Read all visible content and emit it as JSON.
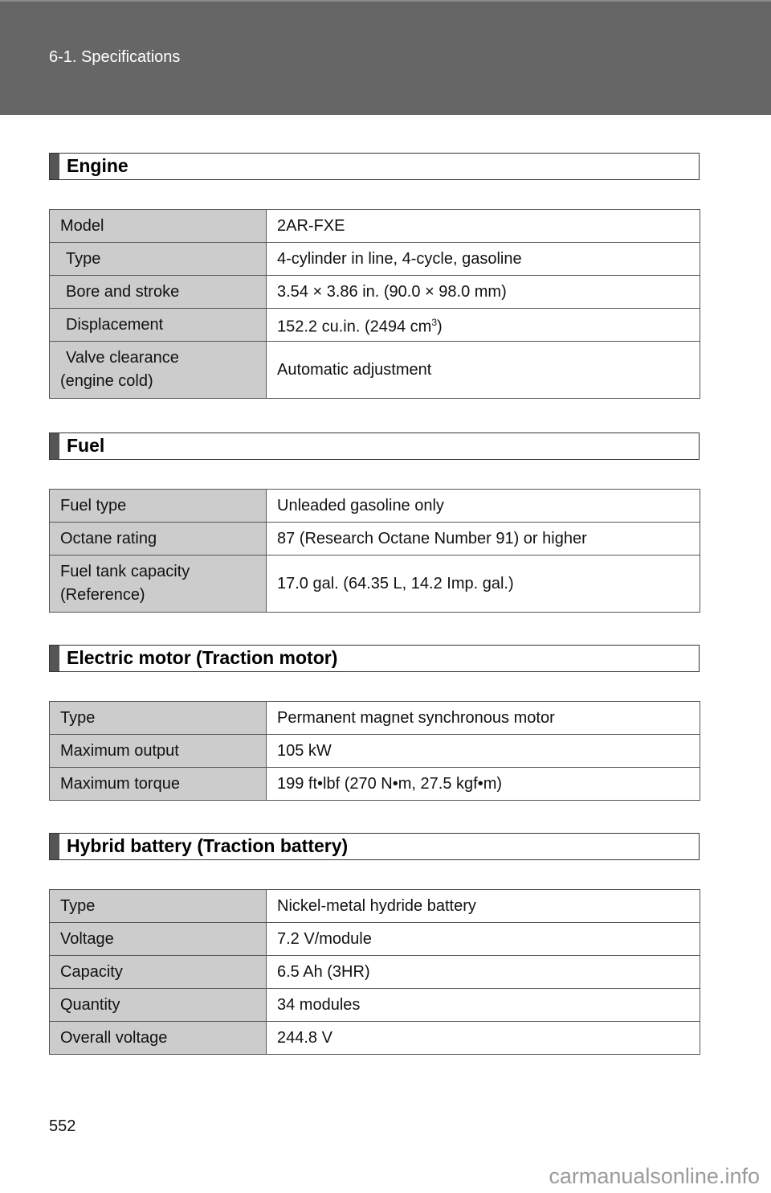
{
  "header": {
    "breadcrumb": "6-1. Specifications"
  },
  "sections": [
    {
      "title": "Engine",
      "rows": [
        {
          "key": "Model",
          "value": "2AR-FXE"
        },
        {
          "key": "Type",
          "value": "4-cylinder in line, 4-cycle, gasoline"
        },
        {
          "key": "Bore and stroke",
          "value": "3.54 × 3.86 in. (90.0 × 98.0 mm)"
        },
        {
          "key": "Displacement",
          "value": "152.2 cu.in. (2494 cm",
          "value_sup": "3",
          "value_after": ")"
        },
        {
          "key": "Valve clearance",
          "key_line2": "(engine cold)",
          "value": "Automatic adjustment"
        }
      ]
    },
    {
      "title": "Fuel",
      "rows": [
        {
          "key": "Fuel type",
          "value": "Unleaded gasoline only"
        },
        {
          "key": "Octane rating",
          "value": "87 (Research Octane Number 91) or higher"
        },
        {
          "key": "Fuel tank capacity",
          "key_line2": "(Reference)",
          "value": "17.0 gal. (64.35 L, 14.2 Imp. gal.)"
        }
      ]
    },
    {
      "title": "Electric motor (Traction motor)",
      "rows": [
        {
          "key": "Type",
          "value": "Permanent magnet synchronous motor"
        },
        {
          "key": "Maximum output",
          "value": "105 kW"
        },
        {
          "key": "Maximum torque",
          "value": "199 ft•lbf (270 N•m, 27.5 kgf•m)"
        }
      ]
    },
    {
      "title": "Hybrid battery (Traction battery)",
      "rows": [
        {
          "key": "Type",
          "value": "Nickel-metal hydride battery"
        },
        {
          "key": "Voltage",
          "value": "7.2 V/module"
        },
        {
          "key": "Capacity",
          "value": "6.5 Ah (3HR)"
        },
        {
          "key": "Quantity",
          "value": "34 modules"
        },
        {
          "key": "Overall voltage",
          "value": "244.8 V"
        }
      ]
    }
  ],
  "footer": {
    "page_number": "552",
    "watermark": "carmanualsonline.info"
  }
}
